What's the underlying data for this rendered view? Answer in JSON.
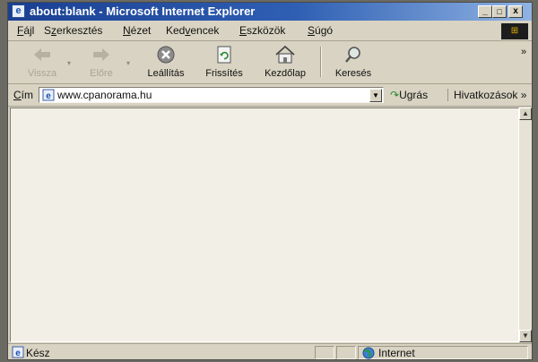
{
  "window": {
    "title": "about:blank - Microsoft Internet Explorer",
    "minimize": "_",
    "maximize": "□",
    "close": "x"
  },
  "menu": [
    {
      "pre": "",
      "u": "F",
      "post": "ájl"
    },
    {
      "pre": "S",
      "u": "z",
      "post": "erkesztés"
    },
    {
      "pre": "",
      "u": "N",
      "post": "ézet"
    },
    {
      "pre": "Ked",
      "u": "v",
      "post": "encek"
    },
    {
      "pre": "",
      "u": "E",
      "post": "szközök"
    },
    {
      "pre": "",
      "u": "S",
      "post": "úgó"
    }
  ],
  "toolbar": {
    "back": "Vissza",
    "forward": "Előre",
    "stop": "Leállítás",
    "refresh": "Frissítés",
    "home": "Kezdőlap",
    "search": "Keresés",
    "more": "»"
  },
  "address": {
    "label_u": "C",
    "label_rest": "ím",
    "value": "www.cpanorama.hu",
    "go": "Ugrás",
    "links": "Hivatkozások »"
  },
  "status": {
    "text": "Kész",
    "zone": "Internet"
  },
  "colors": {
    "titlebar_start": "#1a3f93",
    "titlebar_end": "#8fb3e3",
    "chrome": "#d8d3c2",
    "content": "#f2efe6"
  }
}
